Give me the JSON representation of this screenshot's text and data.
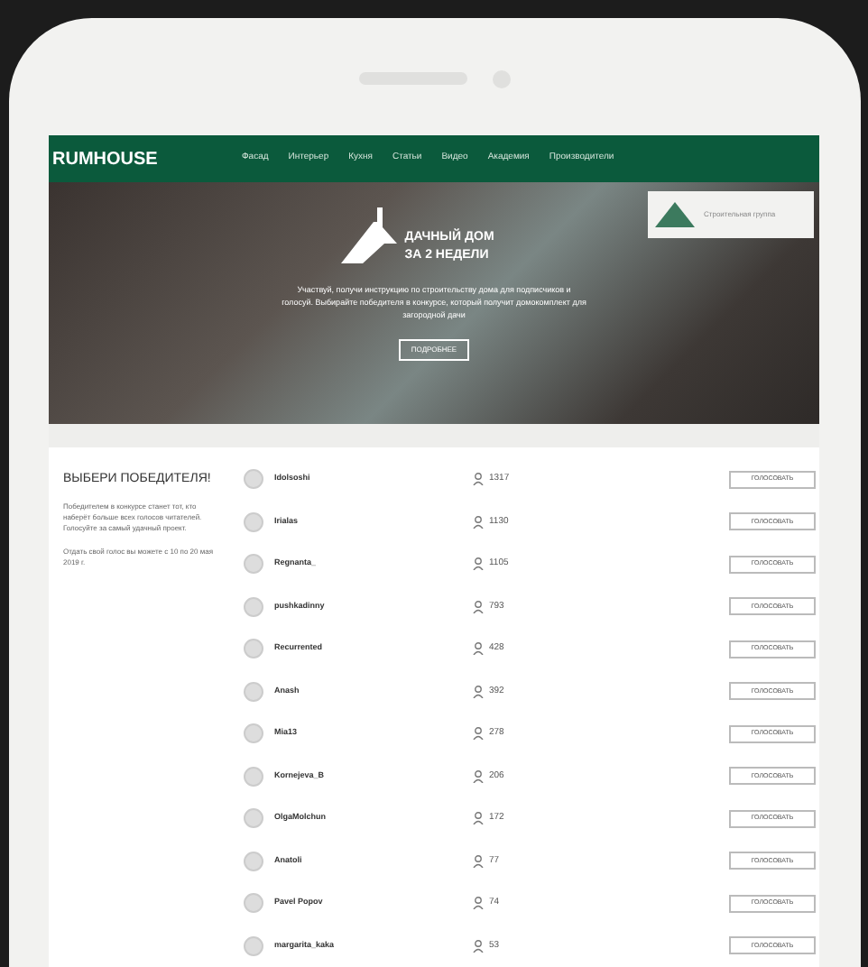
{
  "site": {
    "logo": "RUMHOUSE",
    "nav": [
      "Фасад",
      "Интерьер",
      "Кухня",
      "Статьи",
      "Видео",
      "Академия",
      "Производители"
    ]
  },
  "hero": {
    "title_line_1": "ДАЧНЫЙ ДОМ",
    "title_line_2": "ЗА 2 НЕДЕЛИ",
    "text": "Участвуй, получи инструкцию по строительству дома для подписчиков и голосуй. Выбирайте победителя в конкурсе, который получит домокомплект для загородной дачи",
    "button": "ПОДРОБНЕЕ",
    "ad_text": "Строительная группа"
  },
  "sidebar": {
    "title": "ВЫБЕРИ ПОБЕДИТЕЛЯ!",
    "paragraphs": [
      "Победителем в конкурсе станет тот, кто наберёт больше всех голосов читателей. Голосуйте за самый удачный проект.",
      "Отдать свой голос вы можете с 10 по 20 мая 2019 г."
    ]
  },
  "participants": [
    {
      "name": "Idolsoshi",
      "votes": "1317",
      "button": "ГОЛОСОВАТЬ"
    },
    {
      "name": "Irialas",
      "votes": "1130",
      "button": "ГОЛОСОВАТЬ"
    },
    {
      "name": "Regnanta_",
      "votes": "1105",
      "button": "ГОЛОСОВАТЬ"
    },
    {
      "name": "pushkadinny",
      "votes": "793",
      "button": "ГОЛОСОВАТЬ"
    },
    {
      "name": "Recurrented",
      "votes": "428",
      "button": "ГОЛОСОВАТЬ"
    },
    {
      "name": "Anash",
      "votes": "392",
      "button": "ГОЛОСОВАТЬ"
    },
    {
      "name": "Mia13",
      "votes": "278",
      "button": "ГОЛОСОВАТЬ"
    },
    {
      "name": "Kornejeva_B",
      "votes": "206",
      "button": "ГОЛОСОВАТЬ"
    },
    {
      "name": "OlgaMolchun",
      "votes": "172",
      "button": "ГОЛОСОВАТЬ"
    },
    {
      "name": "Anatoli",
      "votes": "77",
      "button": "ГОЛОСОВАТЬ"
    },
    {
      "name": "Pavel Popov",
      "votes": "74",
      "button": "ГОЛОСОВАТЬ"
    },
    {
      "name": "margarita_kaka",
      "votes": "53",
      "button": "ГОЛОСОВАТЬ"
    }
  ]
}
